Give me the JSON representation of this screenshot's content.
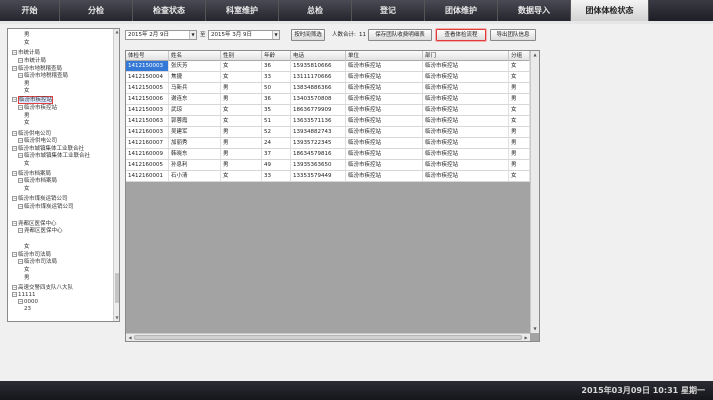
{
  "nav": {
    "tabs": [
      {
        "label": "开始"
      },
      {
        "label": "分检"
      },
      {
        "label": "检查状态"
      },
      {
        "label": "科室维护"
      },
      {
        "label": "总检"
      },
      {
        "label": "登记"
      },
      {
        "label": "团体维护"
      },
      {
        "label": "数据导入"
      },
      {
        "label": "团体体检状态",
        "active": true
      }
    ]
  },
  "tree": {
    "nodes": [
      {
        "label": "男",
        "expander": ""
      },
      {
        "label": "女",
        "expander": ""
      },
      {
        "label": "市统计局",
        "expander": "−"
      },
      {
        "label": "市统计局",
        "expander": "−"
      },
      {
        "label": "临汾市地税稽查局",
        "expander": "−"
      },
      {
        "label": "临汾市地税稽查局",
        "expander": "−"
      },
      {
        "label": "男",
        "expander": ""
      },
      {
        "label": "女",
        "expander": ""
      },
      {
        "label": "临汾市疾控站",
        "expander": "−",
        "selected": true
      },
      {
        "label": "临汾市疾控站",
        "expander": "−"
      },
      {
        "label": "男",
        "expander": ""
      },
      {
        "label": "女",
        "expander": ""
      },
      {
        "label": "临汾供电公司",
        "expander": "−"
      },
      {
        "label": "临汾供电公司",
        "expander": "−"
      },
      {
        "label": "临汾市城镇集体工业联合社",
        "expander": "−"
      },
      {
        "label": "临汾市城镇集体工业联合社",
        "expander": "−"
      },
      {
        "label": "女",
        "expander": ""
      },
      {
        "label": "临汾市档案局",
        "expander": "−"
      },
      {
        "label": "临汾市档案局",
        "expander": "−"
      },
      {
        "label": "女",
        "expander": ""
      },
      {
        "label": "临汾市煤炭运销公司",
        "expander": "−"
      },
      {
        "label": "临汾市煤炭运销公司",
        "expander": "−"
      },
      {
        "label": "",
        "expander": ""
      },
      {
        "label": "尧都区医保中心",
        "expander": "−"
      },
      {
        "label": "尧都区医保中心",
        "expander": "−"
      },
      {
        "label": "",
        "expander": ""
      },
      {
        "label": "女",
        "expander": ""
      },
      {
        "label": "临汾市司法局",
        "expander": "−"
      },
      {
        "label": "临汾市司法局",
        "expander": "−"
      },
      {
        "label": "女",
        "expander": ""
      },
      {
        "label": "男",
        "expander": ""
      },
      {
        "label": "高速交警四支队八大队",
        "expander": "−"
      },
      {
        "label": "11111",
        "expander": "−"
      },
      {
        "label": "0000",
        "expander": "−"
      },
      {
        "label": "23",
        "expander": ""
      }
    ]
  },
  "toolbar": {
    "date_from": "2015年 2月 9日",
    "to_label": "至",
    "date_to": "2015年 3月 9日",
    "filter_button": "按时间筛选",
    "count_label": "人数合计:",
    "count_value": "11",
    "save_button": "保存团队收费明细表",
    "view_button": "查看体检流程",
    "export_button": "导出团队信息"
  },
  "table": {
    "columns": [
      "体检号",
      "姓名",
      "性别",
      "年龄",
      "电话",
      "单位",
      "部门",
      "分组"
    ],
    "rows": [
      [
        "1412150003",
        "张庆芳",
        "女",
        "36",
        "15935810666",
        "临汾市疾控站",
        "临汾市疾控站",
        "女"
      ],
      [
        "1412150004",
        "焦捷",
        "女",
        "33",
        "13111170666",
        "临汾市疾控站",
        "临汾市疾控站",
        "女"
      ],
      [
        "1412150005",
        "马新兵",
        "男",
        "50",
        "13834886366",
        "临汾市疾控站",
        "临汾市疾控站",
        "男"
      ],
      [
        "1412150006",
        "谢连东",
        "男",
        "36",
        "13403570808",
        "临汾市疾控站",
        "临汾市疾控站",
        "男"
      ],
      [
        "1412150003",
        "武琼",
        "女",
        "35",
        "18636779909",
        "临汾市疾控站",
        "临汾市疾控站",
        "女"
      ],
      [
        "1412150063",
        "郭蓉霞",
        "女",
        "51",
        "13633571136",
        "临汾市疾控站",
        "临汾市疾控站",
        "女"
      ],
      [
        "1412160003",
        "吴建军",
        "男",
        "52",
        "13934882743",
        "临汾市疾控站",
        "临汾市疾控站",
        "男"
      ],
      [
        "1412160007",
        "加丽秀",
        "男",
        "24",
        "13935722345",
        "临汾市疾控站",
        "临汾市疾控站",
        "男"
      ],
      [
        "1412160009",
        "韩晓东",
        "男",
        "37",
        "18634579816",
        "临汾市疾控站",
        "临汾市疾控站",
        "男"
      ],
      [
        "1412160005",
        "孙息利",
        "男",
        "49",
        "13935363650",
        "临汾市疾控站",
        "临汾市疾控站",
        "男"
      ],
      [
        "1412160001",
        "石小清",
        "女",
        "33",
        "13353579449",
        "临汾市疾控站",
        "临汾市疾控站",
        "女"
      ]
    ]
  },
  "footer": {
    "datetime": "2015年03月09日 10:31 星期一"
  }
}
